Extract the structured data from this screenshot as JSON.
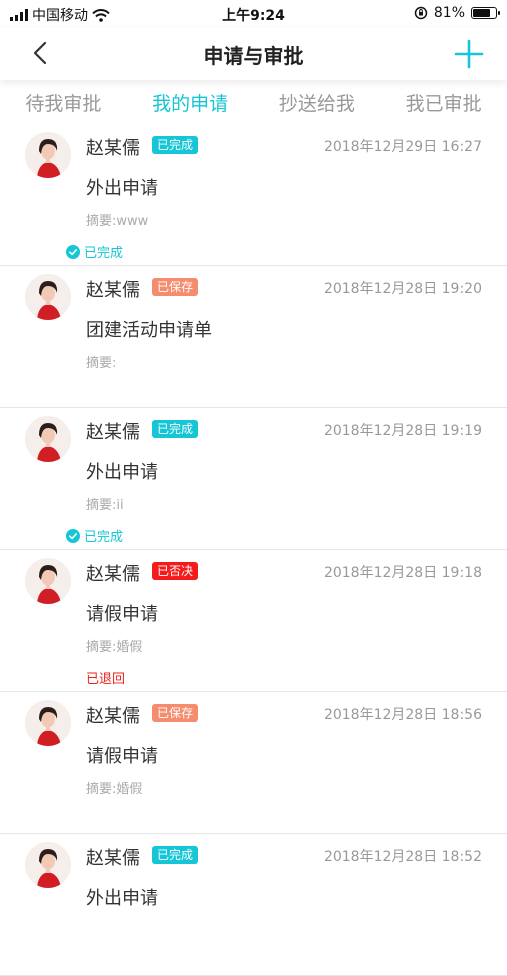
{
  "status_bar": {
    "carrier": "中国移动",
    "time": "上午9:24",
    "battery_pct": "81%",
    "battery_level": 0.81
  },
  "header": {
    "title": "申请与审批",
    "back_icon": "chevron-left-icon",
    "add_icon": "plus-icon"
  },
  "tabs": [
    {
      "label": "待我审批",
      "active": false
    },
    {
      "label": "我的申请",
      "active": true
    },
    {
      "label": "抄送给我",
      "active": false
    },
    {
      "label": "我已审批",
      "active": false
    }
  ],
  "colors": {
    "accent": "#14c6d6",
    "saved": "#f58c6e",
    "rejected": "#f51b1b"
  },
  "items": [
    {
      "name": "赵某儒",
      "badge": "已完成",
      "badge_type": "done",
      "time": "2018年12月29日 16:27",
      "subject": "外出申请",
      "summary": "摘要:www",
      "footer": "已完成",
      "footer_type": "ok"
    },
    {
      "name": "赵某儒",
      "badge": "已保存",
      "badge_type": "saved",
      "time": "2018年12月28日 19:20",
      "subject": "团建活动申请单",
      "summary": "摘要:",
      "footer": "",
      "footer_type": ""
    },
    {
      "name": "赵某儒",
      "badge": "已完成",
      "badge_type": "done",
      "time": "2018年12月28日 19:19",
      "subject": "外出申请",
      "summary": "摘要:ii",
      "footer": "已完成",
      "footer_type": "ok"
    },
    {
      "name": "赵某儒",
      "badge": "已否决",
      "badge_type": "rejected",
      "time": "2018年12月28日 19:18",
      "subject": "请假申请",
      "summary": "摘要:婚假",
      "footer": "已退回",
      "footer_type": "returned"
    },
    {
      "name": "赵某儒",
      "badge": "已保存",
      "badge_type": "saved",
      "time": "2018年12月28日 18:56",
      "subject": "请假申请",
      "summary": "摘要:婚假",
      "footer": "",
      "footer_type": ""
    },
    {
      "name": "赵某儒",
      "badge": "已完成",
      "badge_type": "done",
      "time": "2018年12月28日 18:52",
      "subject": "外出申请",
      "summary": "",
      "footer": "",
      "footer_type": ""
    }
  ]
}
